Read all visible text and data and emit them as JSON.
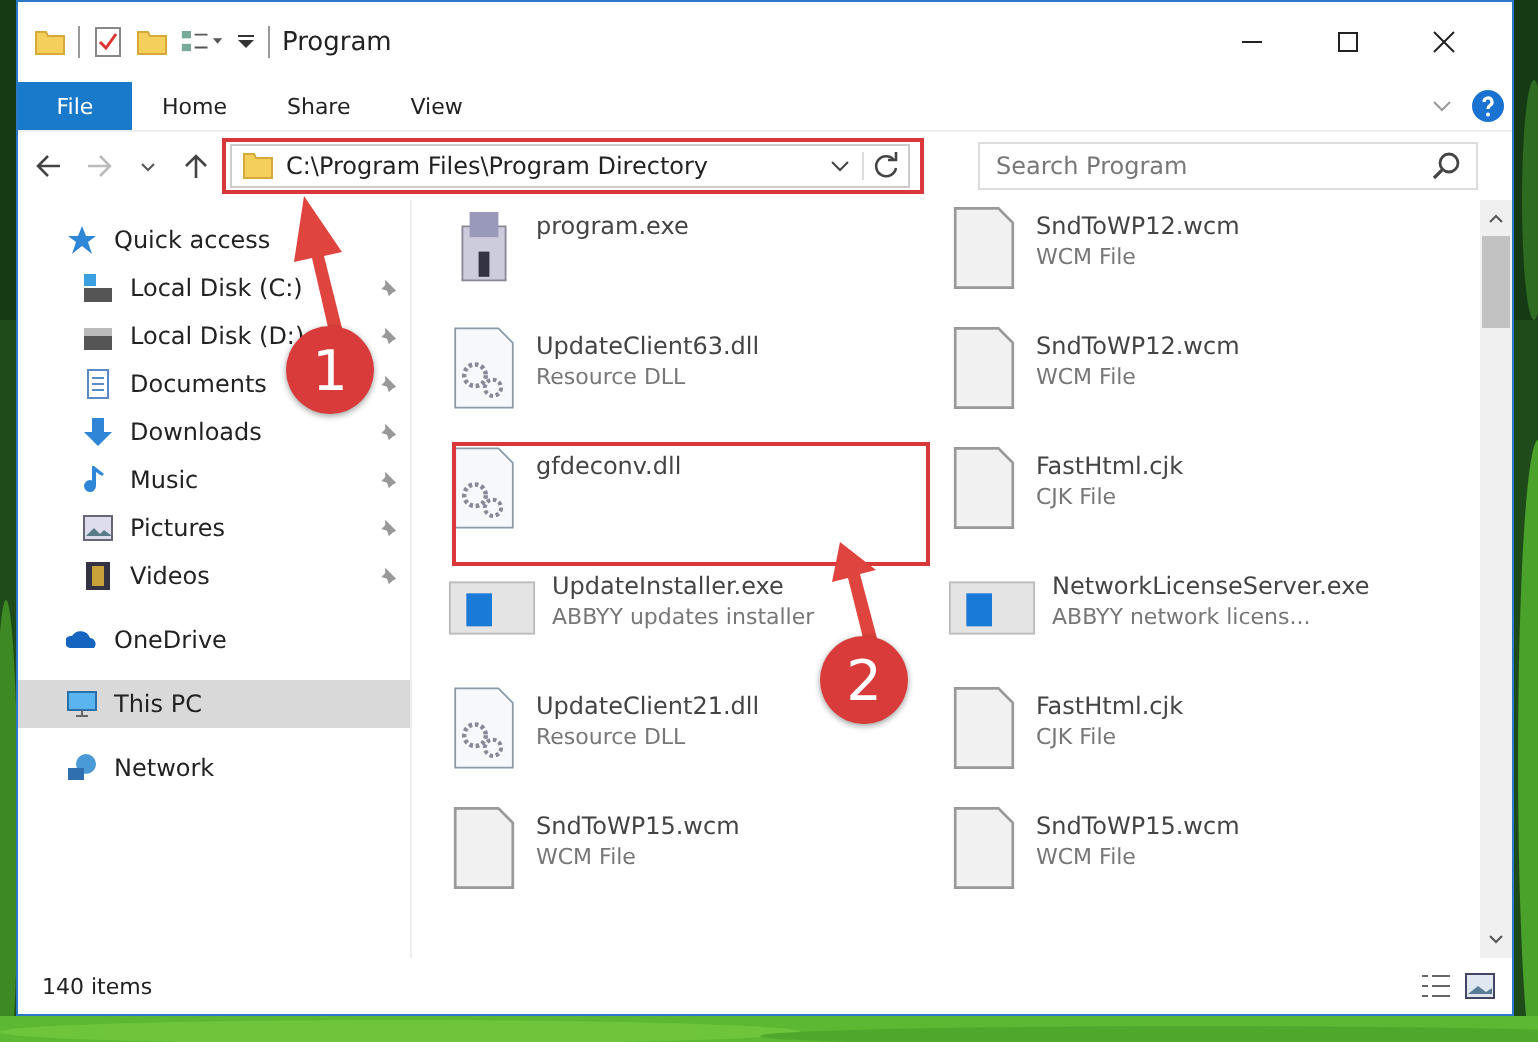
{
  "window": {
    "title": "Program"
  },
  "ribbon_tabs": [
    {
      "label": "File",
      "selected": true
    },
    {
      "label": "Home",
      "selected": false
    },
    {
      "label": "Share",
      "selected": false
    },
    {
      "label": "View",
      "selected": false
    }
  ],
  "address_bar": {
    "path": "C:\\Program Files\\Program Directory"
  },
  "search": {
    "placeholder": "Search Program"
  },
  "sidebar": {
    "items": [
      {
        "label": "Quick access",
        "kind": "star",
        "selected": false,
        "children": [
          {
            "label": "Local Disk (C:)",
            "kind": "disk-c",
            "pinned": true
          },
          {
            "label": "Local Disk (D:)",
            "kind": "disk",
            "pinned": true
          },
          {
            "label": "Documents",
            "kind": "documents",
            "pinned": true
          },
          {
            "label": "Downloads",
            "kind": "downloads",
            "pinned": true
          },
          {
            "label": "Music",
            "kind": "music",
            "pinned": true
          },
          {
            "label": "Pictures",
            "kind": "pictures",
            "pinned": true
          },
          {
            "label": "Videos",
            "kind": "videos",
            "pinned": true
          }
        ]
      },
      {
        "label": "OneDrive",
        "kind": "cloud",
        "selected": false
      },
      {
        "label": "This PC",
        "kind": "pc",
        "selected": true
      },
      {
        "label": "Network",
        "kind": "network",
        "selected": false
      }
    ]
  },
  "files": [
    {
      "name": "program.exe",
      "kind": "app"
    },
    {
      "name": "SndToWP12.wcm",
      "type": "WCM File",
      "kind": "blank"
    },
    {
      "name": "UpdateClient63.dll",
      "type": "Resource DLL",
      "kind": "dll"
    },
    {
      "name": "SndToWP12.wcm",
      "type": "WCM File",
      "kind": "blank"
    },
    {
      "name": "gfdeconv.dll",
      "kind": "dll"
    },
    {
      "name": "FastHtml.cjk",
      "type": "CJK File",
      "kind": "blank"
    },
    {
      "name": "UpdateInstaller.exe",
      "type": "ABBYY updates installer",
      "kind": "window"
    },
    {
      "name": "NetworkLicenseServer.exe",
      "type": "ABBYY network licens...",
      "kind": "window"
    },
    {
      "name": "UpdateClient21.dll",
      "type": "Resource DLL",
      "kind": "dll"
    },
    {
      "name": "FastHtml.cjk",
      "type": "CJK File",
      "kind": "blank"
    },
    {
      "name": "SndToWP15.wcm",
      "type": "WCM File",
      "kind": "blank"
    },
    {
      "name": "SndToWP15.wcm",
      "type": "WCM File",
      "kind": "blank"
    }
  ],
  "status_bar": {
    "count": "140 items"
  },
  "annotations": [
    {
      "label": "1"
    },
    {
      "label": "2"
    }
  ]
}
